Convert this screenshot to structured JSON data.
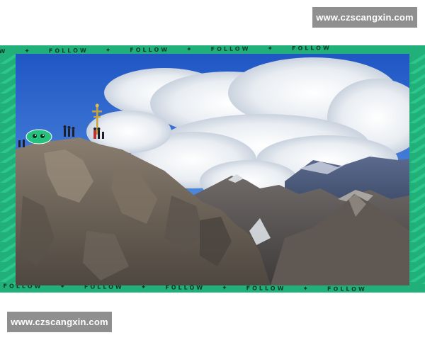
{
  "watermarks": {
    "top": "www.czscangxin.com",
    "bottom": "www.czscangxin.com"
  },
  "frame": {
    "ticker_word": "FOLLOW",
    "accent_color": "#22b07a",
    "text_color": "#0b3b29"
  },
  "photo": {
    "description_icons": [
      "summit-cross-icon",
      "hikers-icon",
      "green-eye-badge-icon"
    ]
  }
}
